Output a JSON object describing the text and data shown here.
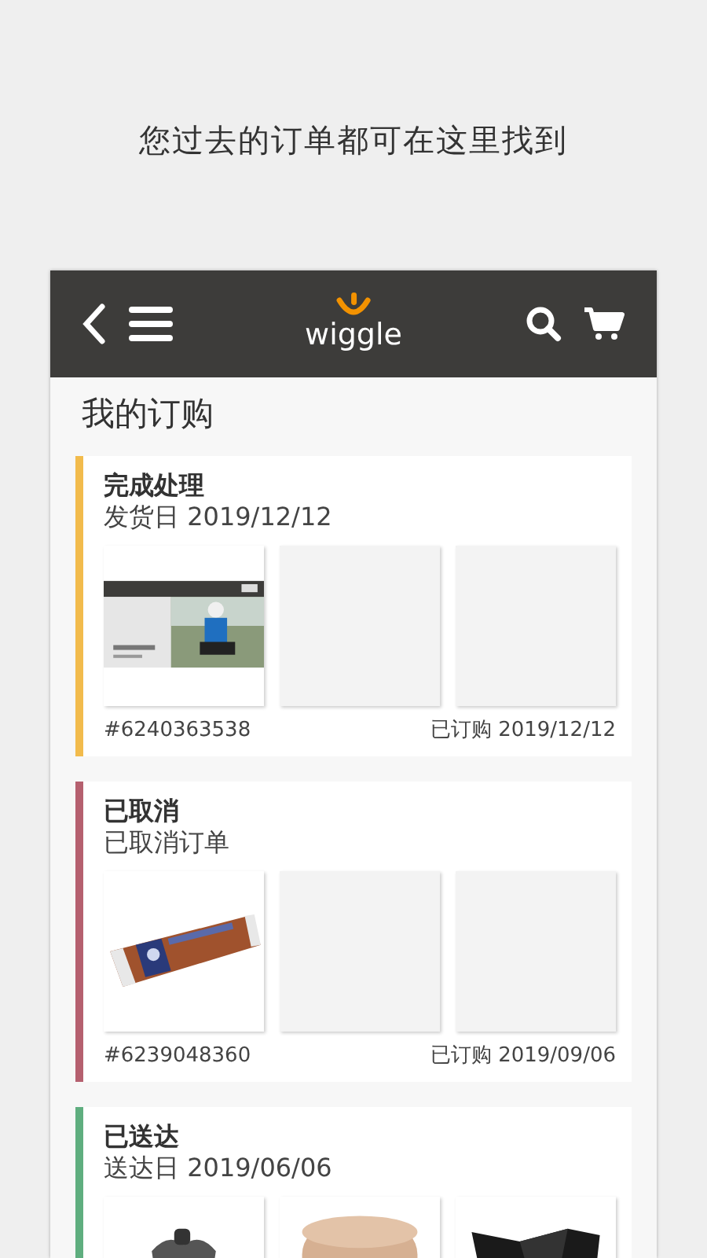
{
  "caption": "您过去的订单都可在这里找到",
  "header": {
    "logo_text": "wiggle"
  },
  "page_title": "我的订购",
  "orders": [
    {
      "status": "完成处理",
      "detail": "发货日 2019/12/12",
      "color": "#f2bb4c",
      "order_number": "#6240363538",
      "ordered": "已订购 2019/12/12",
      "thumbnails": [
        {
          "kind": "picture"
        },
        {
          "kind": "empty"
        },
        {
          "kind": "empty"
        }
      ]
    },
    {
      "status": "已取消",
      "detail": "已取消订单",
      "color": "#b5606f",
      "order_number": "#6239048360",
      "ordered": "已订购 2019/09/06",
      "thumbnails": [
        {
          "kind": "picture"
        },
        {
          "kind": "empty"
        },
        {
          "kind": "empty"
        }
      ]
    },
    {
      "status": "已送达",
      "detail": "送达日 2019/06/06",
      "color": "#5fae7f",
      "thumbnails": [
        {
          "kind": "picture"
        },
        {
          "kind": "picture"
        },
        {
          "kind": "picture"
        }
      ]
    }
  ]
}
